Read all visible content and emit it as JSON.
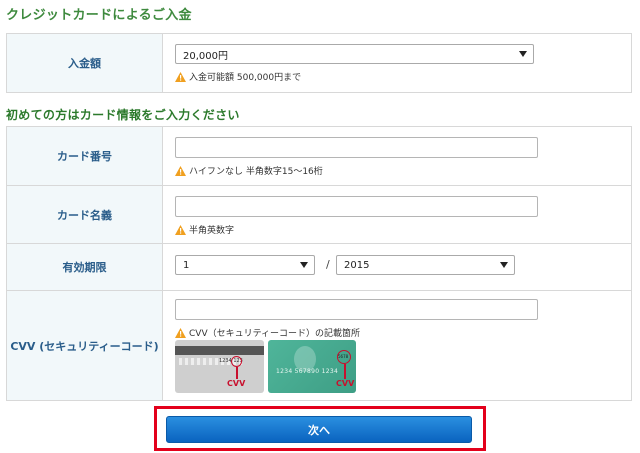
{
  "page": {
    "title": "クレジットカードによるご入金",
    "card_section_title": "初めての方はカード情報をご入力ください"
  },
  "deposit": {
    "label": "入金額",
    "amount_value": "20,000円",
    "note": "入金可能額 500,000円まで"
  },
  "card_number": {
    "label": "カード番号",
    "value": "",
    "note": "ハイフンなし 半角数字15～16桁"
  },
  "card_name": {
    "label": "カード名義",
    "value": "",
    "note": "半角英数字"
  },
  "expiry": {
    "label": "有効期限",
    "month_value": "1",
    "separator": "/",
    "year_value": "2015"
  },
  "cvv": {
    "label": "CVV (セキュリティーコード)",
    "value": "",
    "note": "CVV（セキュリティーコード）の記載箇所",
    "back_card_digits": "1234 123",
    "front_card_number": "1234 567890 1234",
    "front_card_code": "5678",
    "callout_label": "CVV"
  },
  "submit": {
    "label": "次へ"
  },
  "colors": {
    "title_green": "#3e8a3e",
    "label_blue": "#2a5d8a",
    "label_bg": "#f2f8fa",
    "button_blue": "#0a63bf",
    "highlight_red": "#e3001b",
    "warning_orange": "#f0a020"
  }
}
